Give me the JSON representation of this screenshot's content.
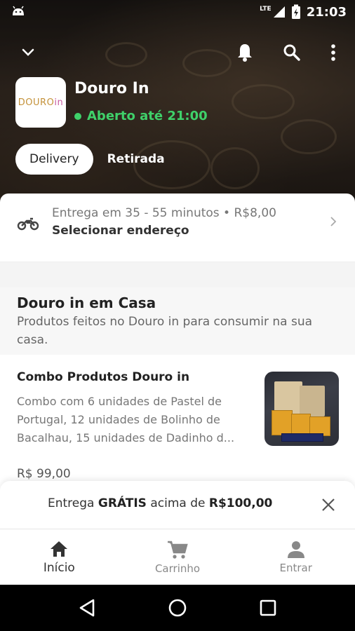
{
  "status_bar": {
    "network": "LTE",
    "time": "21:03"
  },
  "store": {
    "logo_text": "DOURO",
    "logo_text_tail": "in",
    "name": "Douro In",
    "open_status": "Aberto até 21:00"
  },
  "mode": {
    "selected": "Delivery",
    "alternative": "Retirada"
  },
  "delivery": {
    "info": "Entrega em 35 - 55 minutos • R$8,00",
    "address_action": "Selecionar endereço"
  },
  "section": {
    "title": "Douro in em Casa",
    "description": "Produtos feitos no Douro in para consumir na sua casa."
  },
  "product": {
    "name": "Combo Produtos Douro in",
    "description": "Combo com 6 unidades de Pastel de Portugal, 12 unidades de Bolinho de Bacalhau, 15 unidades de Dadinho d...",
    "price": "R$ 99,00"
  },
  "banner": {
    "prefix": "Entrega",
    "highlight": "GRÁTIS",
    "middle": "acima de",
    "amount": "R$100,00"
  },
  "bottom_nav": [
    {
      "label": "Início",
      "icon": "home-icon",
      "active": true
    },
    {
      "label": "Carrinho",
      "icon": "cart-icon",
      "active": false
    },
    {
      "label": "Entrar",
      "icon": "person-icon",
      "active": false
    }
  ],
  "colors": {
    "open_green": "#3fd16a",
    "text_dark": "#222222"
  }
}
